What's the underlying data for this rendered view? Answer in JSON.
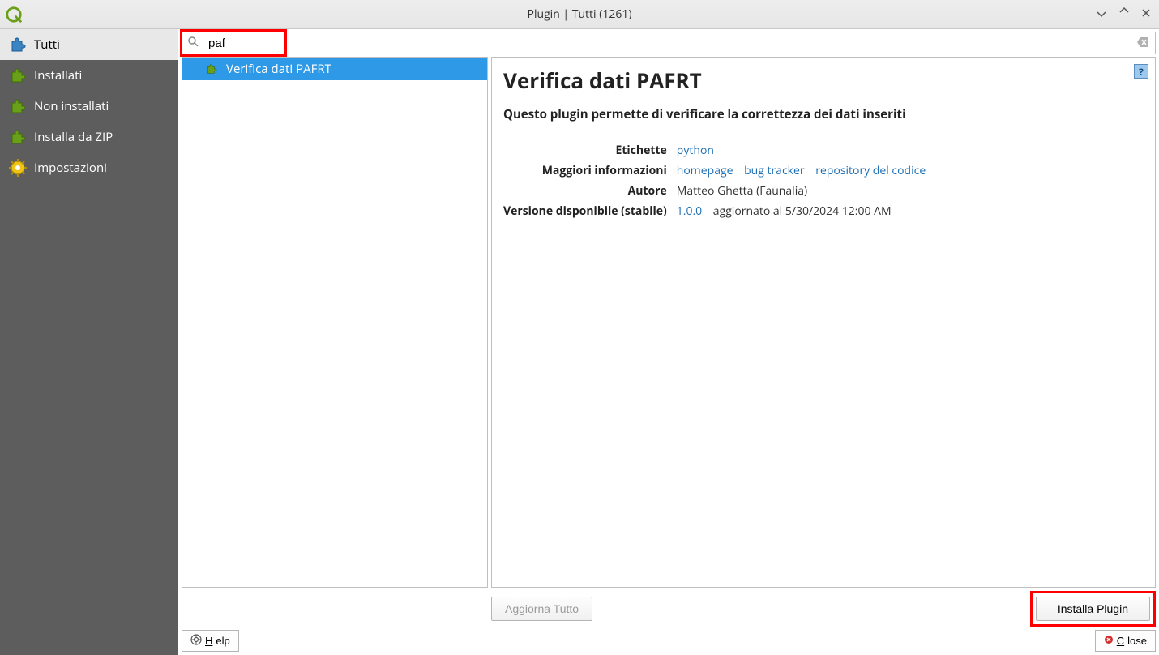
{
  "window": {
    "title": "Plugin | Tutti (1261)"
  },
  "sidebar": {
    "items": [
      {
        "label": "Tutti"
      },
      {
        "label": "Installati"
      },
      {
        "label": "Non installati"
      },
      {
        "label": "Installa da ZIP"
      },
      {
        "label": "Impostazioni"
      }
    ]
  },
  "search": {
    "value": "paf"
  },
  "results": {
    "items": [
      {
        "label": "Verifica dati PAFRT"
      }
    ]
  },
  "detail": {
    "title": "Verifica dati PAFRT",
    "description": "Questo plugin permette di verificare la correttezza dei dati inseriti",
    "rows": {
      "tags_label": "Etichette",
      "tags_link": "python",
      "more_label": "Maggiori informazioni",
      "homepage": "homepage",
      "bugtracker": "bug tracker",
      "repo": "repository del codice",
      "author_label": "Autore",
      "author": "Matteo Ghetta (Faunalia)",
      "version_label": "Versione disponibile (stabile)",
      "version_link": "1.0.0",
      "version_rest": " aggiornato al 5/30/2024 12:00 AM"
    }
  },
  "buttons": {
    "update_all": "Aggiorna Tutto",
    "install": "Installa Plugin",
    "help": "Help",
    "close": "Close"
  }
}
